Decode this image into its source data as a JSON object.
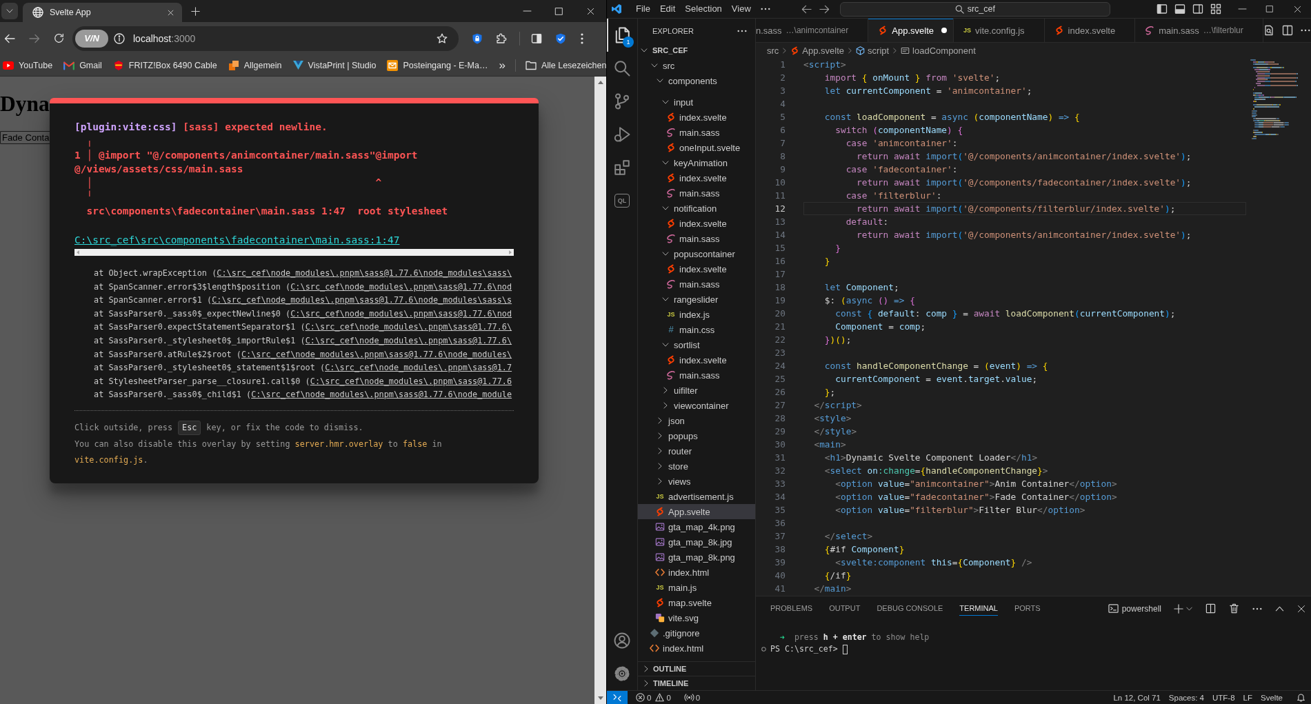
{
  "browser": {
    "tabs": [
      {
        "title": "Svelte App",
        "selected": true
      }
    ],
    "navigation": [
      {
        "kind": "back",
        "disabled": false
      },
      {
        "kind": "forward",
        "disabled": true
      }
    ],
    "omnibox": {
      "vpn_badge": "V/N",
      "host": "localhost",
      "port": ":3000"
    },
    "bookmarks": [
      {
        "label": "YouTube",
        "kind": "video"
      },
      {
        "label": "Gmail",
        "kind": "mail"
      },
      {
        "label": "FRITZ!Box 6490 Cable",
        "kind": "router"
      },
      {
        "label": "Allgemein",
        "kind": "apps"
      },
      {
        "label": "VistaPrint | Studio",
        "kind": "print"
      },
      {
        "label": "Posteingang - E-Ma…",
        "kind": "inbox"
      }
    ],
    "bookmarks_more": "»",
    "all_bookmarks": "Alle Lesezeichen",
    "page": {
      "heading": "Dyna",
      "select_value": "Fade Conta"
    },
    "error_overlay": {
      "plugin": "[plugin:vite:css]",
      "message": "[sass] expected newline.",
      "frame": [
        "  ╷",
        "1 │ @import \"@/components/animcontainer/main.sass\"@import @/views/assets/css/main.sass",
        "  │                                               ^",
        "  ╵",
        "  src\\components\\fadecontainer\\main.sass 1:47  root stylesheet"
      ],
      "file_link": "C:\\src_cef\\src\\components\\fadecontainer\\main.sass:1:47",
      "stack": [
        {
          "call": "at Object.wrapException (",
          "path": "C:\\src_cef\\node_modules\\.pnpm\\sass@1.77.6\\node_modules\\sass\\"
        },
        {
          "call": "at SpanScanner.error$3$length$position (",
          "path": "C:\\src_cef\\node_modules\\.pnpm\\sass@1.77.6\\nod"
        },
        {
          "call": "at SpanScanner.error$1 (",
          "path": "C:\\src_cef\\node_modules\\.pnpm\\sass@1.77.6\\node_modules\\sass\\s"
        },
        {
          "call": "at SassParser0._sass0$_expectNewline$0 (",
          "path": "C:\\src_cef\\node_modules\\.pnpm\\sass@1.77.6\\nod"
        },
        {
          "call": "at SassParser0.expectStatementSeparator$1 (",
          "path": "C:\\src_cef\\node_modules\\.pnpm\\sass@1.77.6\\"
        },
        {
          "call": "at SassParser0._stylesheet0$_importRule$1 (",
          "path": "C:\\src_cef\\node_modules\\.pnpm\\sass@1.77.6\\"
        },
        {
          "call": "at SassParser0.atRule$2$root (",
          "path": "C:\\src_cef\\node_modules\\.pnpm\\sass@1.77.6\\node_modules\\"
        },
        {
          "call": "at SassParser0._stylesheet0$_statement$1$root (",
          "path": "C:\\src_cef\\node_modules\\.pnpm\\sass@1.7"
        },
        {
          "call": "at StylesheetParser_parse__closure1.call$0 (",
          "path": "C:\\src_cef\\node_modules\\.pnpm\\sass@1.77.6"
        },
        {
          "call": "at SassParser0._sass0$_child$1 (",
          "path": "C:\\src_cef\\node_modules\\.pnpm\\sass@1.77.6\\node_module"
        }
      ],
      "hint": {
        "before": "Click outside, press",
        "key": "Esc",
        "after": "key, or fix the code to dismiss."
      },
      "tip": [
        {
          "kind": "plain",
          "text": "You can also disable this overlay by setting "
        },
        {
          "kind": "code",
          "text": "server.hmr.overlay"
        },
        {
          "kind": "plain",
          "text": " to "
        },
        {
          "kind": "code",
          "text": "false"
        },
        {
          "kind": "plain",
          "text": " in "
        },
        {
          "kind": "code",
          "text": "vite.config.js"
        },
        {
          "kind": "plain",
          "text": "."
        }
      ]
    }
  },
  "vscode": {
    "menu": [
      "File",
      "Edit",
      "Selection",
      "View"
    ],
    "command_center": "src_cef",
    "activity": [
      {
        "kind": "files",
        "selected": true,
        "badge": "1"
      },
      {
        "kind": "search",
        "selected": false
      },
      {
        "kind": "scm",
        "selected": false
      },
      {
        "kind": "debug",
        "selected": false
      },
      {
        "kind": "extensions",
        "selected": false
      },
      {
        "kind": "ql",
        "label": "QL",
        "selected": false
      }
    ],
    "activity_bottom": [
      {
        "kind": "account"
      },
      {
        "kind": "settings"
      }
    ],
    "explorer": {
      "title": "EXPLORER",
      "tree": [
        {
          "label": "SRC_CEF",
          "kind": "root",
          "expanded": true,
          "selected": false,
          "children": [
            {
              "label": "src",
              "kind": "folder",
              "expanded": true,
              "selected": false,
              "children": [
                {
                  "label": "components",
                  "kind": "folder",
                  "expanded": true,
                  "selected": false,
                  "children": [
                    {
                      "label": "input",
                      "kind": "folder",
                      "expanded": true,
                      "selected": false,
                      "children": [
                        {
                          "label": "index.svelte",
                          "kind": "svelte",
                          "selected": false
                        },
                        {
                          "label": "main.sass",
                          "kind": "sass",
                          "selected": false
                        },
                        {
                          "label": "oneInput.svelte",
                          "kind": "svelte",
                          "selected": false
                        }
                      ]
                    },
                    {
                      "label": "keyAnimation",
                      "kind": "folder",
                      "expanded": true,
                      "selected": false,
                      "children": [
                        {
                          "label": "index.svelte",
                          "kind": "svelte",
                          "selected": false
                        },
                        {
                          "label": "main.sass",
                          "kind": "sass",
                          "selected": false
                        }
                      ]
                    },
                    {
                      "label": "notification",
                      "kind": "folder",
                      "expanded": true,
                      "selected": false,
                      "children": [
                        {
                          "label": "index.svelte",
                          "kind": "svelte",
                          "selected": false
                        },
                        {
                          "label": "main.sass",
                          "kind": "sass",
                          "selected": false
                        }
                      ]
                    },
                    {
                      "label": "popuscontainer",
                      "kind": "folder",
                      "expanded": true,
                      "selected": false,
                      "children": [
                        {
                          "label": "index.svelte",
                          "kind": "svelte",
                          "selected": false
                        },
                        {
                          "label": "main.sass",
                          "kind": "sass",
                          "selected": false
                        }
                      ]
                    },
                    {
                      "label": "rangeslider",
                      "kind": "folder",
                      "expanded": true,
                      "selected": false,
                      "children": [
                        {
                          "label": "index.js",
                          "kind": "js",
                          "badge": "JS",
                          "selected": false
                        },
                        {
                          "label": "main.css",
                          "kind": "css",
                          "badge": "#",
                          "selected": false
                        }
                      ]
                    },
                    {
                      "label": "sortlist",
                      "kind": "folder",
                      "expanded": true,
                      "selected": false,
                      "children": [
                        {
                          "label": "index.svelte",
                          "kind": "svelte",
                          "selected": false
                        },
                        {
                          "label": "main.sass",
                          "kind": "sass",
                          "selected": false
                        }
                      ]
                    },
                    {
                      "label": "uifilter",
                      "kind": "folder",
                      "expanded": false,
                      "selected": false
                    },
                    {
                      "label": "viewcontainer",
                      "kind": "folder",
                      "expanded": false,
                      "selected": false
                    }
                  ]
                },
                {
                  "label": "json",
                  "kind": "folder",
                  "expanded": false,
                  "selected": false
                },
                {
                  "label": "popups",
                  "kind": "folder",
                  "expanded": false,
                  "selected": false
                },
                {
                  "label": "router",
                  "kind": "folder",
                  "expanded": false,
                  "selected": false
                },
                {
                  "label": "store",
                  "kind": "folder",
                  "expanded": false,
                  "selected": false
                },
                {
                  "label": "views",
                  "kind": "folder",
                  "expanded": false,
                  "selected": false
                },
                {
                  "label": "advertisement.js",
                  "kind": "js",
                  "badge": "JS",
                  "selected": false
                },
                {
                  "label": "App.svelte",
                  "kind": "svelte",
                  "selected": true
                },
                {
                  "label": "gta_map_4k.png",
                  "kind": "image",
                  "selected": false
                },
                {
                  "label": "gta_map_8k.jpg",
                  "kind": "image",
                  "selected": false
                },
                {
                  "label": "gta_map_8k.png",
                  "kind": "image",
                  "selected": false
                },
                {
                  "label": "index.html",
                  "kind": "html",
                  "selected": false
                },
                {
                  "label": "main.js",
                  "kind": "js",
                  "badge": "JS",
                  "selected": false
                },
                {
                  "label": "map.svelte",
                  "kind": "svelte",
                  "selected": false
                },
                {
                  "label": "vite.svg",
                  "kind": "svg",
                  "selected": false
                }
              ]
            },
            {
              "label": ".gitignore",
              "kind": "git",
              "selected": false
            },
            {
              "label": "index.html",
              "kind": "html",
              "selected": false
            }
          ]
        }
      ],
      "sections": [
        {
          "label": "OUTLINE",
          "expanded": false
        },
        {
          "label": "TIMELINE",
          "expanded": false
        }
      ]
    },
    "tabs": [
      {
        "label": "n.sass",
        "detail": "…\\animcontainer",
        "selected": false,
        "modified": false
      },
      {
        "label": "App.svelte",
        "kind": "svelte",
        "selected": true,
        "modified": true
      },
      {
        "label": "vite.config.js",
        "kind": "js",
        "badge": "JS",
        "selected": false,
        "modified": false
      },
      {
        "label": "index.svelte",
        "kind": "svelte",
        "selected": false,
        "modified": false
      },
      {
        "label": "main.sass",
        "detail": "…\\filterblur",
        "kind": "sass",
        "selected": false,
        "modified": false
      }
    ],
    "breadcrumbs": [
      {
        "label": "src"
      },
      {
        "label": "App.svelte",
        "kind": "svelte"
      },
      {
        "label": "script",
        "kind": "module"
      },
      {
        "label": "loadComponent",
        "kind": "method"
      }
    ],
    "code": [
      {
        "number": "1",
        "current": false,
        "tokens": [
          {
            "kind": "tagpunct",
            "text": "<"
          },
          {
            "kind": "tag",
            "text": "script"
          },
          {
            "kind": "tagpunct",
            "text": ">"
          }
        ]
      },
      {
        "number": "2",
        "current": false,
        "tokens": [
          {
            "kind": "keyword",
            "text": "    import"
          },
          {
            "kind": "brace1",
            "text": " {"
          },
          {
            "kind": "variable",
            "text": " onMount "
          },
          {
            "kind": "brace1",
            "text": "}"
          },
          {
            "kind": "keyword",
            "text": " from"
          },
          {
            "kind": "string",
            "text": " 'svelte'"
          },
          {
            "kind": "text",
            "text": ";"
          }
        ]
      },
      {
        "number": "3",
        "current": false,
        "tokens": [
          {
            "kind": "storage",
            "text": "    let"
          },
          {
            "kind": "variable",
            "text": " currentComponent"
          },
          {
            "kind": "text",
            "text": " = "
          },
          {
            "kind": "string",
            "text": "'animcontainer'"
          },
          {
            "kind": "text",
            "text": ";"
          }
        ]
      },
      {
        "number": "4",
        "current": false
      },
      {
        "number": "5",
        "current": false,
        "tokens": [
          {
            "kind": "storage",
            "text": "    const"
          },
          {
            "kind": "function",
            "text": " loadComponent"
          },
          {
            "kind": "text",
            "text": " = "
          },
          {
            "kind": "storage",
            "text": "async"
          },
          {
            "kind": "brace1",
            "text": " ("
          },
          {
            "kind": "variable",
            "text": "componentName"
          },
          {
            "kind": "brace1",
            "text": ")"
          },
          {
            "kind": "storage",
            "text": " =>"
          },
          {
            "kind": "brace1",
            "text": " {"
          }
        ]
      },
      {
        "number": "6",
        "current": false,
        "tokens": [
          {
            "kind": "keyword",
            "text": "      switch"
          },
          {
            "kind": "brace2",
            "text": " ("
          },
          {
            "kind": "variable",
            "text": "componentName"
          },
          {
            "kind": "brace2",
            "text": ")"
          },
          {
            "kind": "brace2",
            "text": " {"
          }
        ]
      },
      {
        "number": "7",
        "current": false,
        "tokens": [
          {
            "kind": "keyword",
            "text": "        case"
          },
          {
            "kind": "string",
            "text": " 'animcontainer'"
          },
          {
            "kind": "text",
            "text": ":"
          }
        ]
      },
      {
        "number": "8",
        "current": false,
        "tokens": [
          {
            "kind": "keyword",
            "text": "          return await"
          },
          {
            "kind": "storage",
            "text": " import"
          },
          {
            "kind": "brace3",
            "text": "("
          },
          {
            "kind": "string",
            "text": "'@/components/animcontainer/index.svelte'"
          },
          {
            "kind": "brace3",
            "text": ")"
          },
          {
            "kind": "text",
            "text": ";"
          }
        ]
      },
      {
        "number": "9",
        "current": false,
        "tokens": [
          {
            "kind": "keyword",
            "text": "        case"
          },
          {
            "kind": "string",
            "text": " 'fadecontainer'"
          },
          {
            "kind": "text",
            "text": ":"
          }
        ]
      },
      {
        "number": "10",
        "current": false,
        "tokens": [
          {
            "kind": "keyword",
            "text": "          return await"
          },
          {
            "kind": "storage",
            "text": " import"
          },
          {
            "kind": "brace3",
            "text": "("
          },
          {
            "kind": "string",
            "text": "'@/components/fadecontainer/index.svelte'"
          },
          {
            "kind": "brace3",
            "text": ")"
          },
          {
            "kind": "text",
            "text": ";"
          }
        ]
      },
      {
        "number": "11",
        "current": false,
        "tokens": [
          {
            "kind": "keyword",
            "text": "        case"
          },
          {
            "kind": "string",
            "text": " 'filterblur'"
          },
          {
            "kind": "text",
            "text": ":"
          }
        ]
      },
      {
        "number": "12",
        "current": true,
        "tokens": [
          {
            "kind": "keyword",
            "text": "          return await"
          },
          {
            "kind": "storage",
            "text": " import"
          },
          {
            "kind": "brace3",
            "text": "("
          },
          {
            "kind": "string",
            "text": "'@/components/filterblur/index.svelte'"
          },
          {
            "kind": "brace3",
            "text": ")"
          },
          {
            "kind": "text",
            "text": ";"
          }
        ]
      },
      {
        "number": "13",
        "current": false,
        "tokens": [
          {
            "kind": "keyword",
            "text": "        default"
          },
          {
            "kind": "text",
            "text": ":"
          }
        ]
      },
      {
        "number": "14",
        "current": false,
        "tokens": [
          {
            "kind": "keyword",
            "text": "          return await"
          },
          {
            "kind": "storage",
            "text": " import"
          },
          {
            "kind": "brace3",
            "text": "("
          },
          {
            "kind": "string",
            "text": "'@/components/animcontainer/index.svelte'"
          },
          {
            "kind": "brace3",
            "text": ")"
          },
          {
            "kind": "text",
            "text": ";"
          }
        ]
      },
      {
        "number": "15",
        "current": false,
        "tokens": [
          {
            "kind": "brace2",
            "text": "      }"
          }
        ]
      },
      {
        "number": "16",
        "current": false,
        "tokens": [
          {
            "kind": "brace1",
            "text": "    }"
          }
        ]
      },
      {
        "number": "17",
        "current": false
      },
      {
        "number": "18",
        "current": false,
        "tokens": [
          {
            "kind": "storage",
            "text": "    let"
          },
          {
            "kind": "variable",
            "text": " Component"
          },
          {
            "kind": "text",
            "text": ";"
          }
        ]
      },
      {
        "number": "19",
        "current": false,
        "tokens": [
          {
            "kind": "text",
            "text": "    $: "
          },
          {
            "kind": "brace1",
            "text": "("
          },
          {
            "kind": "storage",
            "text": "async"
          },
          {
            "kind": "brace2",
            "text": " ()"
          },
          {
            "kind": "storage",
            "text": " =>"
          },
          {
            "kind": "brace2",
            "text": " {"
          }
        ]
      },
      {
        "number": "20",
        "current": false,
        "tokens": [
          {
            "kind": "storage",
            "text": "      const"
          },
          {
            "kind": "brace3",
            "text": " {"
          },
          {
            "kind": "variable",
            "text": " default"
          },
          {
            "kind": "text",
            "text": ": "
          },
          {
            "kind": "variable",
            "text": "comp "
          },
          {
            "kind": "brace3",
            "text": "}"
          },
          {
            "kind": "text",
            "text": " = "
          },
          {
            "kind": "keyword",
            "text": "await"
          },
          {
            "kind": "function",
            "text": " loadComponent"
          },
          {
            "kind": "brace3",
            "text": "("
          },
          {
            "kind": "variable",
            "text": "currentComponent"
          },
          {
            "kind": "brace3",
            "text": ")"
          },
          {
            "kind": "text",
            "text": ";"
          }
        ]
      },
      {
        "number": "21",
        "current": false,
        "tokens": [
          {
            "kind": "variable",
            "text": "      Component"
          },
          {
            "kind": "text",
            "text": " = "
          },
          {
            "kind": "variable",
            "text": "comp"
          },
          {
            "kind": "text",
            "text": ";"
          }
        ]
      },
      {
        "number": "22",
        "current": false,
        "tokens": [
          {
            "kind": "brace2",
            "text": "    }"
          },
          {
            "kind": "brace1",
            "text": ")()"
          },
          {
            "kind": "text",
            "text": ";"
          }
        ]
      },
      {
        "number": "23",
        "current": false
      },
      {
        "number": "24",
        "current": false,
        "tokens": [
          {
            "kind": "storage",
            "text": "    const"
          },
          {
            "kind": "function",
            "text": " handleComponentChange"
          },
          {
            "kind": "text",
            "text": " = "
          },
          {
            "kind": "brace1",
            "text": "("
          },
          {
            "kind": "variable",
            "text": "event"
          },
          {
            "kind": "brace1",
            "text": ")"
          },
          {
            "kind": "storage",
            "text": " =>"
          },
          {
            "kind": "brace1",
            "text": " {"
          }
        ]
      },
      {
        "number": "25",
        "current": false,
        "tokens": [
          {
            "kind": "variable",
            "text": "      currentComponent"
          },
          {
            "kind": "text",
            "text": " = "
          },
          {
            "kind": "variable",
            "text": "event"
          },
          {
            "kind": "text",
            "text": "."
          },
          {
            "kind": "variable",
            "text": "target"
          },
          {
            "kind": "text",
            "text": "."
          },
          {
            "kind": "variable",
            "text": "value"
          },
          {
            "kind": "text",
            "text": ";"
          }
        ]
      },
      {
        "number": "26",
        "current": false,
        "tokens": [
          {
            "kind": "brace1",
            "text": "    }"
          },
          {
            "kind": "text",
            "text": ";"
          }
        ]
      },
      {
        "number": "27",
        "current": false,
        "tokens": [
          {
            "kind": "tagpunct",
            "text": "  </"
          },
          {
            "kind": "tag",
            "text": "script"
          },
          {
            "kind": "tagpunct",
            "text": ">"
          }
        ]
      },
      {
        "number": "28",
        "current": false,
        "tokens": [
          {
            "kind": "tagpunct",
            "text": "  <"
          },
          {
            "kind": "tag",
            "text": "style"
          },
          {
            "kind": "tagpunct",
            "text": ">"
          }
        ]
      },
      {
        "number": "29",
        "current": false,
        "tokens": [
          {
            "kind": "tagpunct",
            "text": "  </"
          },
          {
            "kind": "tag",
            "text": "style"
          },
          {
            "kind": "tagpunct",
            "text": ">"
          }
        ]
      },
      {
        "number": "30",
        "current": false,
        "tokens": [
          {
            "kind": "tagpunct",
            "text": "  <"
          },
          {
            "kind": "tag",
            "text": "main"
          },
          {
            "kind": "tagpunct",
            "text": ">"
          }
        ]
      },
      {
        "number": "31",
        "current": false,
        "tokens": [
          {
            "kind": "tagpunct",
            "text": "    <"
          },
          {
            "kind": "tag",
            "text": "h1"
          },
          {
            "kind": "tagpunct",
            "text": ">"
          },
          {
            "kind": "text",
            "text": "Dynamic Svelte Component Loader"
          },
          {
            "kind": "tagpunct",
            "text": "</"
          },
          {
            "kind": "tag",
            "text": "h1"
          },
          {
            "kind": "tagpunct",
            "text": ">"
          }
        ]
      },
      {
        "number": "32",
        "current": false,
        "tokens": [
          {
            "kind": "tagpunct",
            "text": "    <"
          },
          {
            "kind": "tag",
            "text": "select"
          },
          {
            "kind": "variable",
            "text": " on"
          },
          {
            "kind": "directive",
            "text": ":change"
          },
          {
            "kind": "text",
            "text": "="
          },
          {
            "kind": "brace1",
            "text": "{"
          },
          {
            "kind": "function",
            "text": "handleComponentChange"
          },
          {
            "kind": "brace1",
            "text": "}"
          },
          {
            "kind": "tagpunct",
            "text": ">"
          }
        ]
      },
      {
        "number": "33",
        "current": false,
        "tokens": [
          {
            "kind": "tagpunct",
            "text": "      <"
          },
          {
            "kind": "tag",
            "text": "option"
          },
          {
            "kind": "variable",
            "text": " value"
          },
          {
            "kind": "text",
            "text": "="
          },
          {
            "kind": "string",
            "text": "\"animcontainer\""
          },
          {
            "kind": "tagpunct",
            "text": ">"
          },
          {
            "kind": "text",
            "text": "Anim Container"
          },
          {
            "kind": "tagpunct",
            "text": "</"
          },
          {
            "kind": "tag",
            "text": "option"
          },
          {
            "kind": "tagpunct",
            "text": ">"
          }
        ]
      },
      {
        "number": "34",
        "current": false,
        "tokens": [
          {
            "kind": "tagpunct",
            "text": "      <"
          },
          {
            "kind": "tag",
            "text": "option"
          },
          {
            "kind": "variable",
            "text": " value"
          },
          {
            "kind": "text",
            "text": "="
          },
          {
            "kind": "string",
            "text": "\"fadecontainer\""
          },
          {
            "kind": "tagpunct",
            "text": ">"
          },
          {
            "kind": "text",
            "text": "Fade Container"
          },
          {
            "kind": "tagpunct",
            "text": "</"
          },
          {
            "kind": "tag",
            "text": "option"
          },
          {
            "kind": "tagpunct",
            "text": ">"
          }
        ]
      },
      {
        "number": "35",
        "current": false,
        "tokens": [
          {
            "kind": "tagpunct",
            "text": "      <"
          },
          {
            "kind": "tag",
            "text": "option"
          },
          {
            "kind": "variable",
            "text": " value"
          },
          {
            "kind": "text",
            "text": "="
          },
          {
            "kind": "string",
            "text": "\"filterblur\""
          },
          {
            "kind": "tagpunct",
            "text": ">"
          },
          {
            "kind": "text",
            "text": "Filter Blur"
          },
          {
            "kind": "tagpunct",
            "text": "</"
          },
          {
            "kind": "tag",
            "text": "option"
          },
          {
            "kind": "tagpunct",
            "text": ">"
          }
        ]
      },
      {
        "number": "36",
        "current": false
      },
      {
        "number": "37",
        "current": false,
        "tokens": [
          {
            "kind": "tagpunct",
            "text": "    </"
          },
          {
            "kind": "tag",
            "text": "select"
          },
          {
            "kind": "tagpunct",
            "text": ">"
          }
        ]
      },
      {
        "number": "38",
        "current": false,
        "tokens": [
          {
            "kind": "brace1",
            "text": "    {"
          },
          {
            "kind": "text",
            "text": "#if"
          },
          {
            "kind": "variable",
            "text": " Component"
          },
          {
            "kind": "brace1",
            "text": "}"
          }
        ]
      },
      {
        "number": "39",
        "current": false,
        "tokens": [
          {
            "kind": "tagpunct",
            "text": "      <"
          },
          {
            "kind": "tag",
            "text": "svelte:component"
          },
          {
            "kind": "variable",
            "text": " this"
          },
          {
            "kind": "text",
            "text": "="
          },
          {
            "kind": "brace1",
            "text": "{"
          },
          {
            "kind": "variable",
            "text": "Component"
          },
          {
            "kind": "brace1",
            "text": "}"
          },
          {
            "kind": "tagpunct",
            "text": " />"
          }
        ]
      },
      {
        "number": "40",
        "current": false,
        "tokens": [
          {
            "kind": "brace1",
            "text": "    {"
          },
          {
            "kind": "text",
            "text": "/if"
          },
          {
            "kind": "brace1",
            "text": "}"
          }
        ]
      },
      {
        "number": "41",
        "current": false,
        "tokens": [
          {
            "kind": "tagpunct",
            "text": "  </"
          },
          {
            "kind": "tag",
            "text": "main"
          },
          {
            "kind": "tagpunct",
            "text": ">"
          }
        ]
      }
    ],
    "panel": {
      "tabs": [
        {
          "label": "PROBLEMS",
          "selected": false
        },
        {
          "label": "OUTPUT",
          "selected": false
        },
        {
          "label": "DEBUG CONSOLE",
          "selected": false
        },
        {
          "label": "TERMINAL",
          "selected": true
        },
        {
          "label": "PORTS",
          "selected": false
        }
      ],
      "terminal_name": "powershell",
      "terminal": [
        {
          "kind": "hint",
          "marker": "➜",
          "text": "press **h + enter** to show help"
        },
        {
          "kind": "prompt",
          "text": "PS C:\\src_cef>"
        }
      ]
    },
    "status_bar": {
      "errors": "0",
      "warnings": "0",
      "ports": "0",
      "items": [
        "Ln 12, Col 71",
        "Spaces: 4",
        "UTF-8",
        "LF",
        "Svelte"
      ]
    }
  }
}
